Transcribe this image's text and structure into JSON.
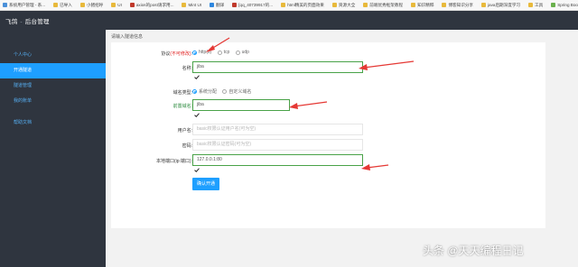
{
  "bookmarks": [
    {
      "label": "系统用户管理 - 系...",
      "color": "#4a90d9"
    },
    {
      "label": "已导入",
      "color": "#e8b93b"
    },
    {
      "label": "小猪招呼",
      "color": "#e8b93b"
    },
    {
      "label": "UI",
      "color": "#e8b93b"
    },
    {
      "label": "axios的post请求用...",
      "color": "#c0392b"
    },
    {
      "label": "Mint UI",
      "color": "#e8b93b"
    },
    {
      "label": "翻译",
      "color": "#2e86de"
    },
    {
      "label": "[qq_40739917的...",
      "color": "#c0392b"
    },
    {
      "label": "html精美的页面效果",
      "color": "#e8b93b"
    },
    {
      "label": "资源大全",
      "color": "#e8b93b"
    },
    {
      "label": "前端优秀框架教程",
      "color": "#e8b93b"
    },
    {
      "label": "知识精粹",
      "color": "#e8b93b"
    },
    {
      "label": "博客知识分享",
      "color": "#e8b93b"
    },
    {
      "label": "java后期深度学习",
      "color": "#e8b93b"
    },
    {
      "label": "工具",
      "color": "#e8b93b"
    },
    {
      "label": "Spring Boot：内容",
      "color": "#6ab04c"
    }
  ],
  "header": {
    "brand": "飞鸽",
    "separator": " - ",
    "title": "后台管理"
  },
  "sidebar": {
    "items": [
      {
        "label": "个人中心",
        "active": false
      },
      {
        "label": "开通隧道",
        "active": true
      },
      {
        "label": "隧道管理",
        "active": false
      },
      {
        "label": "我的账单",
        "active": false
      },
      {
        "label": "帮助文档",
        "active": false
      }
    ]
  },
  "breadcrumb": "请输入隧道信息",
  "form": {
    "protocol": {
      "label": "协议",
      "note": "(不可修改)",
      "suffix": ":",
      "options": [
        {
          "label": "http(s)",
          "selected": true
        },
        {
          "label": "tcp",
          "selected": false
        },
        {
          "label": "udp",
          "selected": false
        }
      ]
    },
    "name": {
      "label": "名称:",
      "value": "jiba"
    },
    "domain_type": {
      "label": "域名类型:",
      "options": [
        {
          "label": "系统分配",
          "selected": true
        },
        {
          "label": "自定义域名",
          "selected": false
        }
      ]
    },
    "prefix": {
      "label": "前置域名:",
      "value": "jiba"
    },
    "username": {
      "label": "用户名:",
      "placeholder": "basic权限认证用户名(可为空)"
    },
    "password": {
      "label": "密码:",
      "placeholder": "basic权限认证密码(可为空)"
    },
    "local_port": {
      "label": "本地端口(ip:端口):",
      "value": "127.0.0.1:80"
    },
    "submit_label": "确认开通"
  },
  "colors": {
    "accent": "#1e9fff",
    "sidebar_bg": "#2f353f",
    "success": "#49a248",
    "annotation_arrow": "#e53935"
  },
  "watermark": "头条 @天天编程日记"
}
